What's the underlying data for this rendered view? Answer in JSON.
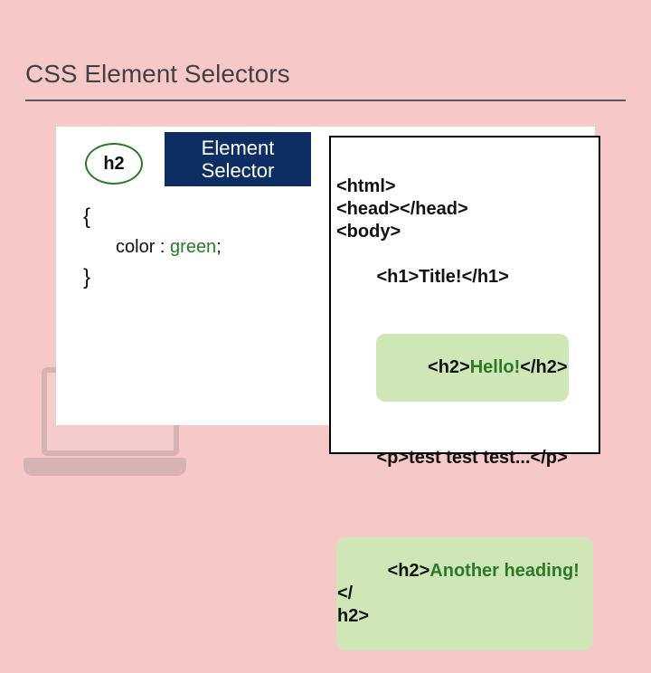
{
  "title": "CSS Element Selectors",
  "selector_name": "h2",
  "selector_label": "Element\nSelector",
  "css": {
    "open": "{",
    "prop": "color",
    "colon": " : ",
    "value": "green",
    "semi": ";",
    "close": "}"
  },
  "code": {
    "l1": "<html>",
    "l2": "<head></head>",
    "l3": "<body>",
    "l4a": "<h1>",
    "l4b": "Title!",
    "l4c": "</h1>",
    "l5a": "<h2>",
    "l5b": "Hello!",
    "l5c": "</h2>",
    "l6a": "<p>",
    "l6b": "test test test...",
    "l6c": "</p>",
    "l7a": "<h2>",
    "l7b": "Another heading!",
    "l7c": "</h2>"
  }
}
